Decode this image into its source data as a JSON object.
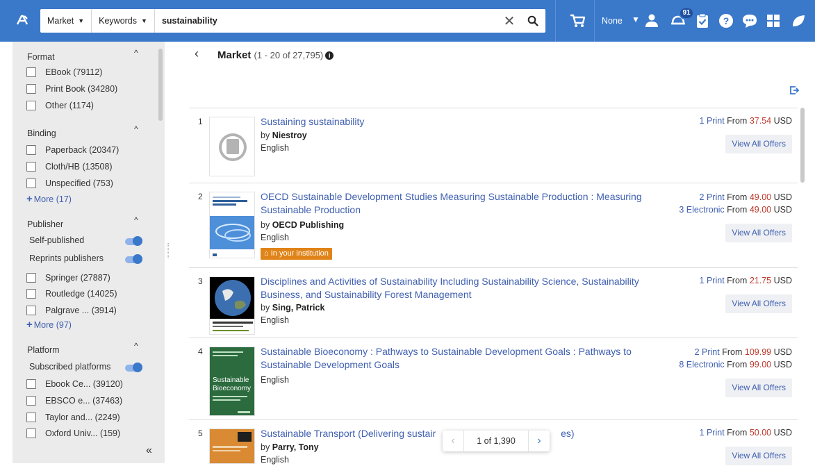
{
  "topbar": {
    "scope": "Market",
    "field": "Keywords",
    "query": "sustainability",
    "selection": "None",
    "notification_count": "91"
  },
  "sidebar": {
    "facets": {
      "format": {
        "title": "Format",
        "items": [
          {
            "label": "EBook (79112)"
          },
          {
            "label": "Print Book (34280)"
          },
          {
            "label": "Other (1174)"
          }
        ]
      },
      "binding": {
        "title": "Binding",
        "items": [
          {
            "label": "Paperback (20347)"
          },
          {
            "label": "Cloth/HB (13508)"
          },
          {
            "label": "Unspecified (753)"
          }
        ],
        "more": "More (17)"
      },
      "publisher": {
        "title": "Publisher",
        "switches": [
          {
            "label": "Self-published"
          },
          {
            "label": "Reprints publishers"
          }
        ],
        "items": [
          {
            "label": "Springer (27887)"
          },
          {
            "label": "Routledge (14025)"
          },
          {
            "label": "Palgrave ...  (3914)"
          }
        ],
        "more": "More (97)"
      },
      "platform": {
        "title": "Platform",
        "switches": [
          {
            "label": "Subscribed platforms"
          }
        ],
        "items": [
          {
            "label": "Ebook Ce... (39120)"
          },
          {
            "label": "EBSCO e... (37463)"
          },
          {
            "label": "Taylor and... (2249)"
          },
          {
            "label": "Oxford Univ... (159)"
          }
        ]
      }
    }
  },
  "main": {
    "title": "Market",
    "range": "(1 - 20 of 27,795)",
    "view_all_label": "View All Offers",
    "from_label": "From",
    "results": [
      {
        "num": "1",
        "title": "Sustaining sustainability",
        "by": "by",
        "author": "Niestroy",
        "language": "English",
        "offers": [
          {
            "kind": "1 Print",
            "price": "37.54",
            "currency": "USD"
          }
        ]
      },
      {
        "num": "2",
        "title": "OECD Sustainable Development Studies Measuring Sustainable Production : Measuring Sustainable Production",
        "by": "by",
        "author": "OECD Publishing",
        "language": "English",
        "badge": "In your institution",
        "offers": [
          {
            "kind": "2 Print",
            "price": "49.00",
            "currency": "USD"
          },
          {
            "kind": "3 Electronic",
            "price": "49.00",
            "currency": "USD"
          }
        ]
      },
      {
        "num": "3",
        "title": "Disciplines and Activities of Sustainability Including Sustainability Science, Sustainability Business, and Sustainability Forest Management",
        "by": "by",
        "author": "Sing, Patrick",
        "language": "English",
        "offers": [
          {
            "kind": "1 Print",
            "price": "21.75",
            "currency": "USD"
          }
        ]
      },
      {
        "num": "4",
        "title": "Sustainable Bioeconomy : Pathways to Sustainable Development Goals : Pathways to Sustainable Development Goals",
        "language": "English",
        "offers": [
          {
            "kind": "2 Print",
            "price": "109.99",
            "currency": "USD"
          },
          {
            "kind": "8 Electronic",
            "price": "99.00",
            "currency": "USD"
          }
        ],
        "cover_text": "Sustainable Bioeconomy"
      },
      {
        "num": "5",
        "title": "Sustainable Transport (Delivering sustair",
        "title_tail": "es)",
        "by": "by",
        "author": "Parry, Tony",
        "language": "English",
        "offers": [
          {
            "kind": "1 Print",
            "price": "50.00",
            "currency": "USD"
          }
        ]
      }
    ],
    "pager": {
      "text": "1 of 1,390"
    }
  },
  "colors": {
    "topbar": "#3a78c9",
    "link": "#3f5fb0",
    "price": "#c0392b",
    "badge": "#e08318",
    "sidebar": "#ebebeb"
  }
}
